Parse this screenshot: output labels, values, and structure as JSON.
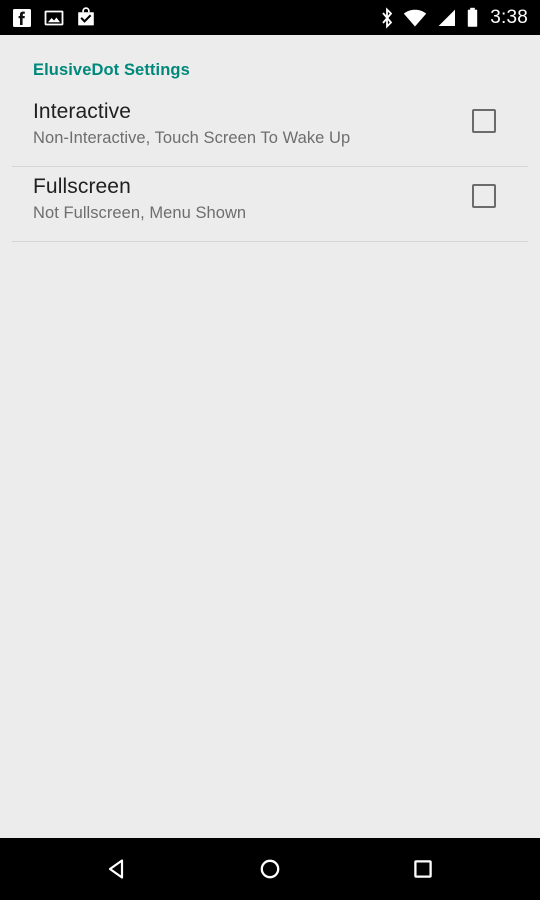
{
  "status_bar": {
    "background": "#000000",
    "foreground": "#FFFFFF",
    "time": "3:38",
    "left_icons": [
      {
        "name": "facebook-icon",
        "label": "Facebook"
      },
      {
        "name": "photo-image-icon",
        "label": "Image"
      },
      {
        "name": "bag-check-icon",
        "label": "Download Complete"
      }
    ],
    "right_icons": [
      {
        "name": "bluetooth-icon",
        "label": "Bluetooth"
      },
      {
        "name": "wifi-icon",
        "label": "Wi-Fi"
      },
      {
        "name": "cellular-signal-icon",
        "label": "Cellular Signal"
      },
      {
        "name": "battery-icon",
        "label": "Battery"
      }
    ]
  },
  "screen": {
    "background": "#ECECEC",
    "accent": "#00897B",
    "header": "ElusiveDot Settings"
  },
  "preferences": [
    {
      "title": "Interactive",
      "summary": "Non-Interactive, Touch Screen To Wake Up",
      "checked": false
    },
    {
      "title": "Fullscreen",
      "summary": "Not Fullscreen, Menu Shown",
      "checked": false
    }
  ],
  "nav_bar": {
    "background": "#000000",
    "buttons": [
      {
        "name": "back-button",
        "label": "Back"
      },
      {
        "name": "home-button",
        "label": "Home"
      },
      {
        "name": "recents-button",
        "label": "Recents"
      }
    ]
  }
}
